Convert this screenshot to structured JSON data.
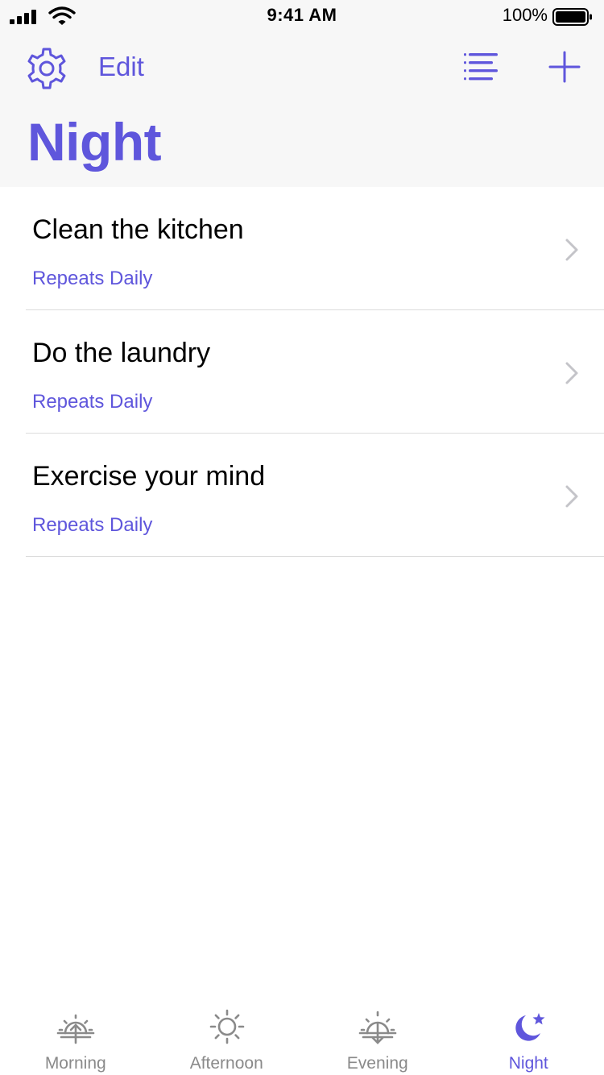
{
  "status_bar": {
    "time": "9:41 AM",
    "battery_percent": "100%",
    "icons": [
      "cellular-signal-icon",
      "wifi-icon",
      "battery-icon"
    ]
  },
  "nav": {
    "settings_icon": "gear-icon",
    "edit_label": "Edit",
    "sort_icon": "list-icon",
    "add_icon": "plus-icon"
  },
  "page": {
    "title": "Night"
  },
  "tasks": [
    {
      "title": "Clean the kitchen",
      "subtitle": "Repeats Daily"
    },
    {
      "title": "Do the laundry",
      "subtitle": "Repeats Daily"
    },
    {
      "title": "Exercise your mind",
      "subtitle": "Repeats Daily"
    }
  ],
  "tab_bar": {
    "selected": "Night",
    "tabs": [
      {
        "label": "Morning",
        "icon": "sunrise-icon"
      },
      {
        "label": "Afternoon",
        "icon": "sun-icon"
      },
      {
        "label": "Evening",
        "icon": "sunset-icon"
      },
      {
        "label": "Night",
        "icon": "moon-star-icon"
      }
    ]
  },
  "colors": {
    "accent": "#5f56dc",
    "header_bg": "#f7f7f7",
    "inactive_tab": "#8a8a8a",
    "separator": "#dcdcdc"
  }
}
